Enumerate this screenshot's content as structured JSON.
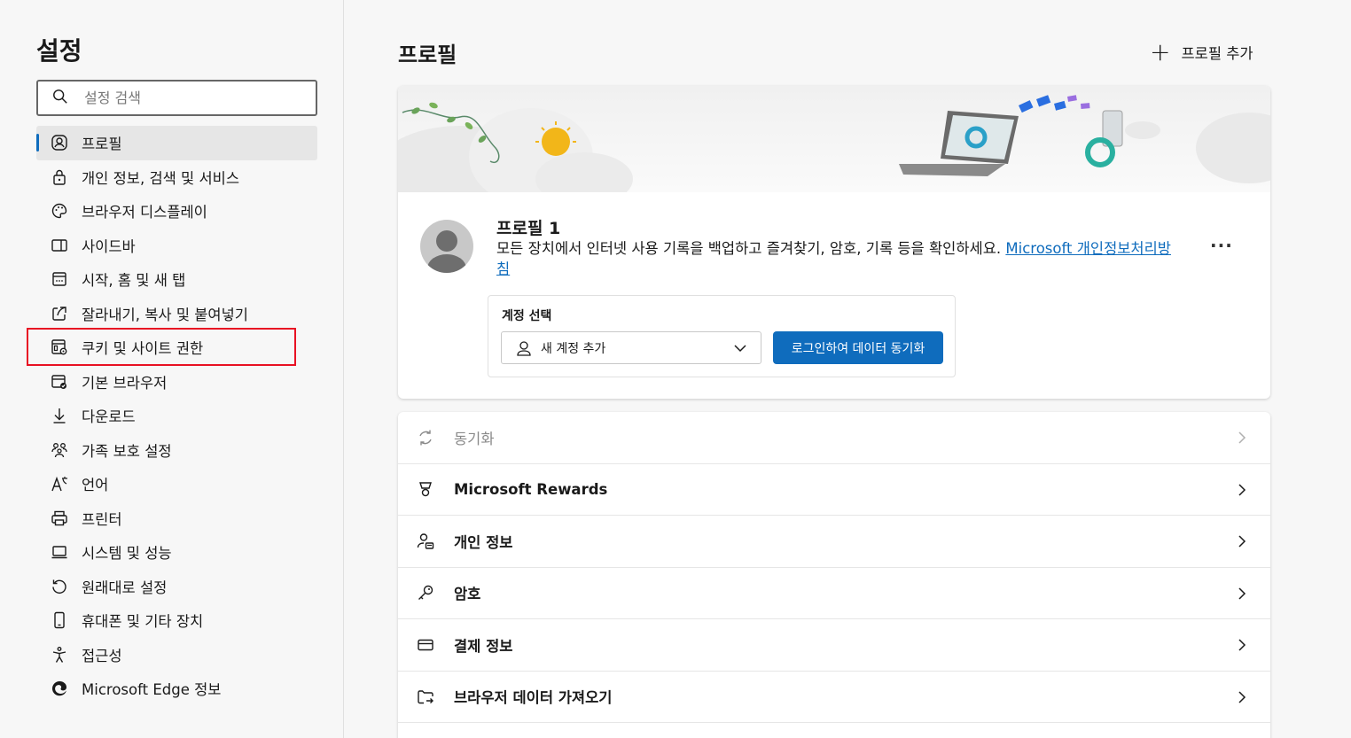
{
  "sidebar": {
    "title": "설정",
    "search_placeholder": "설정 검색",
    "items": [
      {
        "label": "프로필",
        "icon": "profile-icon"
      },
      {
        "label": "개인 정보, 검색 및 서비스",
        "icon": "lock-icon"
      },
      {
        "label": "브라우저 디스플레이",
        "icon": "palette-icon"
      },
      {
        "label": "사이드바",
        "icon": "sidebar-icon"
      },
      {
        "label": "시작, 홈 및 새 탭",
        "icon": "home-grid-icon"
      },
      {
        "label": "잘라내기, 복사 및 붙여넣기",
        "icon": "share-icon"
      },
      {
        "label": "쿠키 및 사이트 권한",
        "icon": "cookie-settings-icon"
      },
      {
        "label": "기본 브라우저",
        "icon": "default-browser-icon"
      },
      {
        "label": "다운로드",
        "icon": "download-icon"
      },
      {
        "label": "가족 보호 설정",
        "icon": "family-icon"
      },
      {
        "label": "언어",
        "icon": "language-icon"
      },
      {
        "label": "프린터",
        "icon": "printer-icon"
      },
      {
        "label": "시스템 및 성능",
        "icon": "laptop-icon"
      },
      {
        "label": "원래대로 설정",
        "icon": "reset-icon"
      },
      {
        "label": "휴대폰 및 기타 장치",
        "icon": "phone-icon"
      },
      {
        "label": "접근성",
        "icon": "accessibility-icon"
      },
      {
        "label": "Microsoft Edge 정보",
        "icon": "edge-icon"
      }
    ],
    "active_index": 0,
    "highlight_color": "#e81123"
  },
  "main": {
    "title": "프로필",
    "add_profile_label": "프로필 추가",
    "profile": {
      "name": "프로필 1",
      "description": "모든 장치에서 인터넷 사용 기록을 백업하고 즐겨찾기, 암호, 기록 등을 확인하세요.",
      "privacy_link": "Microsoft 개인정보처리방침",
      "more_label": "···"
    },
    "account": {
      "label": "계정 선택",
      "selected": "새 계정 추가",
      "sync_button": "로그인하여 데이터 동기화"
    },
    "rows": [
      {
        "label": "동기화",
        "icon": "sync-icon",
        "disabled": true
      },
      {
        "label": "Microsoft Rewards",
        "icon": "rewards-icon",
        "disabled": false
      },
      {
        "label": "개인 정보",
        "icon": "personal-info-icon",
        "disabled": false
      },
      {
        "label": "암호",
        "icon": "key-icon",
        "disabled": false
      },
      {
        "label": "결제 정보",
        "icon": "card-icon",
        "disabled": false
      },
      {
        "label": "브라우저 데이터 가져오기",
        "icon": "import-icon",
        "disabled": false
      }
    ]
  },
  "colors": {
    "accent": "#0f6cbd",
    "background": "#f7f7f7"
  }
}
